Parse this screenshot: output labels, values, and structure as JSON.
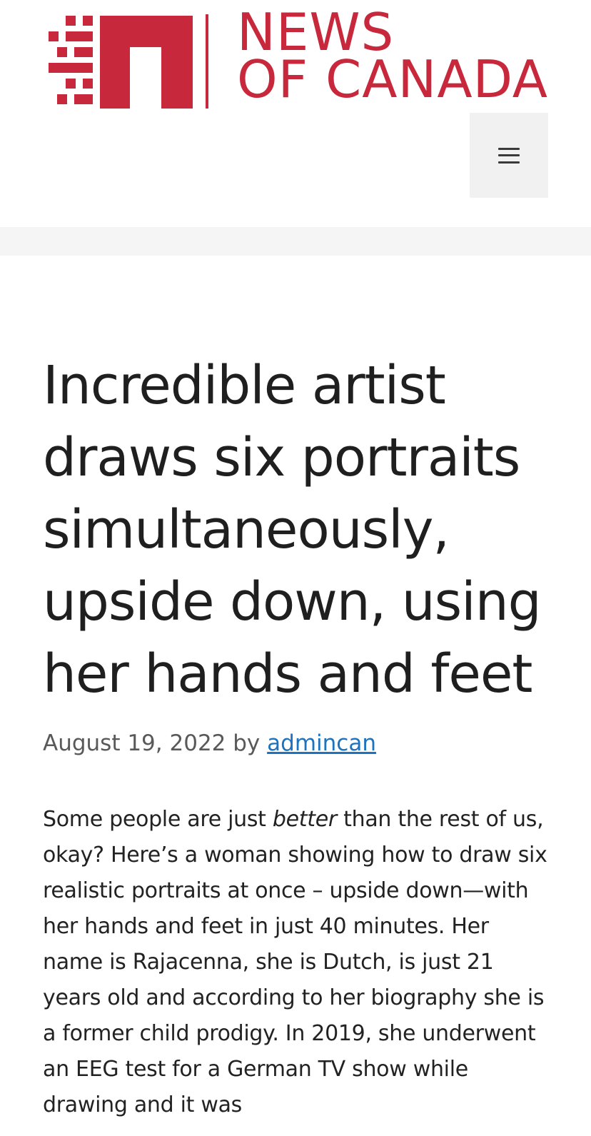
{
  "site": {
    "logo_line1": "NEWS",
    "logo_line2": "OF CANADA",
    "brand_color": "#c8283c",
    "menu_icon": "hamburger-menu-icon"
  },
  "article": {
    "title": "Incredible artist draws six portraits simultaneously, upside down, using her hands and feet",
    "date": "August 19, 2022",
    "by": "by",
    "author": "admincan",
    "link_color": "#1e73be",
    "paragraph": {
      "part1": "Some people are just ",
      "emphasis": "better",
      "part2": " than the rest of us, okay? Here’s a woman showing how to draw six realistic portraits at once – upside down—with her hands and feet in just 40 minutes. Her name is Rajacenna, she is Dutch, is just 21 years old and according to her biography she is a former child prodigy. In 2019, she underwent an EEG test for a German TV show while drawing and it was"
    }
  }
}
